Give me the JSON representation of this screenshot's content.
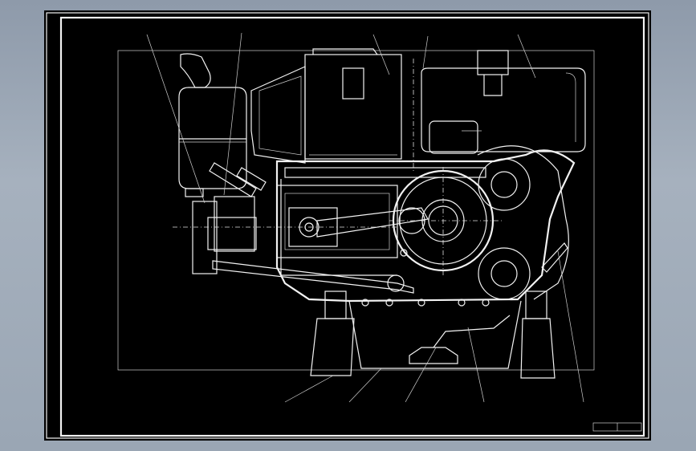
{
  "drawing": {
    "callouts": [],
    "title_block": {
      "cells": []
    }
  }
}
